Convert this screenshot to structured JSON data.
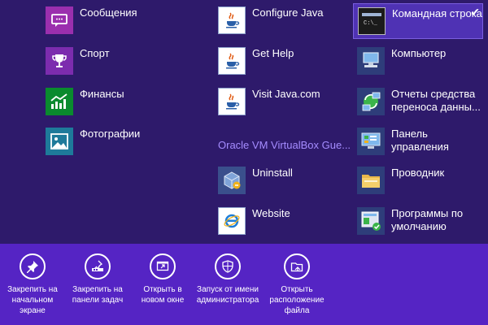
{
  "colors": {
    "background": "#2e1a6b",
    "appbar": "#5524c4",
    "group_header": "#a58cff",
    "selected": "#4f32b4"
  },
  "col1": [
    {
      "label": "Сообщения",
      "icon": "messaging-icon",
      "color": "#9b2fae"
    },
    {
      "label": "Спорт",
      "icon": "trophy-icon",
      "color": "#7c2cae"
    },
    {
      "label": "Финансы",
      "icon": "finance-chart-icon",
      "color": "#0a8a2e"
    },
    {
      "label": "Фотографии",
      "icon": "photos-icon",
      "color": "#1e7a9a"
    }
  ],
  "col2_top": [
    {
      "label": "Configure Java",
      "icon": "java-icon"
    },
    {
      "label": "Get Help",
      "icon": "java-icon"
    },
    {
      "label": "Visit Java.com",
      "icon": "java-icon"
    }
  ],
  "group_header": "Oracle VM VirtualBox Gue...",
  "col2_bottom": [
    {
      "label": "Uninstall",
      "icon": "virtualbox-uninstall-icon"
    },
    {
      "label": "Website",
      "icon": "internet-explorer-icon"
    }
  ],
  "col3": [
    {
      "label": "Командная строка",
      "icon": "command-prompt-icon",
      "selected": true
    },
    {
      "label": "Компьютер",
      "icon": "computer-icon"
    },
    {
      "label": "Отчеты средства\nпереноса данны...",
      "icon": "migration-reports-icon"
    },
    {
      "label": "Панель\nуправления",
      "icon": "control-panel-icon"
    },
    {
      "label": "Проводник",
      "icon": "folder-explorer-icon"
    },
    {
      "label": "Программы по\nумолчанию",
      "icon": "default-programs-icon"
    }
  ],
  "appbar": [
    {
      "label": "Закрепить на\nначальном\nэкране",
      "icon": "pin-start-icon"
    },
    {
      "label": "Закрепить на\nпанели задач",
      "icon": "pin-taskbar-icon"
    },
    {
      "label": "Открыть в\nновом окне",
      "icon": "new-window-icon"
    },
    {
      "label": "Запуск от имени\nадминистратора",
      "icon": "run-as-admin-icon"
    },
    {
      "label": "Открыть\nрасположение\nфайла",
      "icon": "open-file-location-icon"
    }
  ]
}
